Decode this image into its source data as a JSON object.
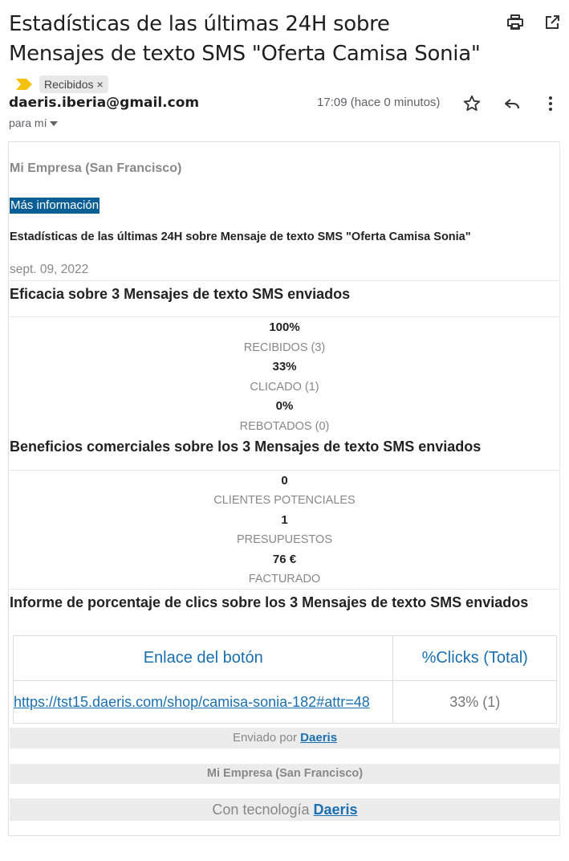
{
  "subject": {
    "title": "Estadísticas de las últimas 24H sobre Mensajes de texto SMS \"Oferta Camisa Sonia\"",
    "label": "Recibidos",
    "label_close": "×"
  },
  "header": {
    "sender": "daeris.iberia@gmail.com",
    "to_me": "para mí",
    "time": "17:09 (hace 0 minutos)"
  },
  "email": {
    "company": "Mi Empresa (San Francisco)",
    "more_info": "Más información",
    "stats_title": "Estadísticas de las últimas 24H sobre Mensaje de texto SMS \"Oferta Camisa Sonia\"",
    "date": "sept. 09, 2022",
    "efficacy": {
      "heading": "Eficacia sobre 3 Mensajes de texto SMS enviados",
      "stats": [
        {
          "value": "100%",
          "label": "RECIBIDOS (3)"
        },
        {
          "value": "33%",
          "label": "CLICADO (1)"
        },
        {
          "value": "0%",
          "label": "REBOTADOS (0)"
        }
      ]
    },
    "benefits": {
      "heading": "Beneficios comerciales sobre los 3 Mensajes de texto SMS enviados",
      "stats": [
        {
          "value": "0",
          "label": "CLIENTES POTENCIALES"
        },
        {
          "value": "1",
          "label": "PRESUPUESTOS"
        },
        {
          "value": "76 €",
          "label": "FACTURADO"
        }
      ]
    },
    "clicks": {
      "heading": "Informe de porcentaje de clics sobre los 3 Mensajes de texto SMS enviados",
      "col_link": "Enlace del botón",
      "col_clicks": "%Clicks (Total)",
      "rows": [
        {
          "link": "https://tst15.daeris.com/shop/camisa-sonia-182#attr=48",
          "clicks": "33% (1)"
        }
      ]
    },
    "footer": {
      "sent_by": "Enviado por",
      "sent_by_link": "Daeris",
      "company": "Mi Empresa (San Francisco)",
      "powered": "Con tecnología",
      "powered_link": "Daeris"
    }
  }
}
